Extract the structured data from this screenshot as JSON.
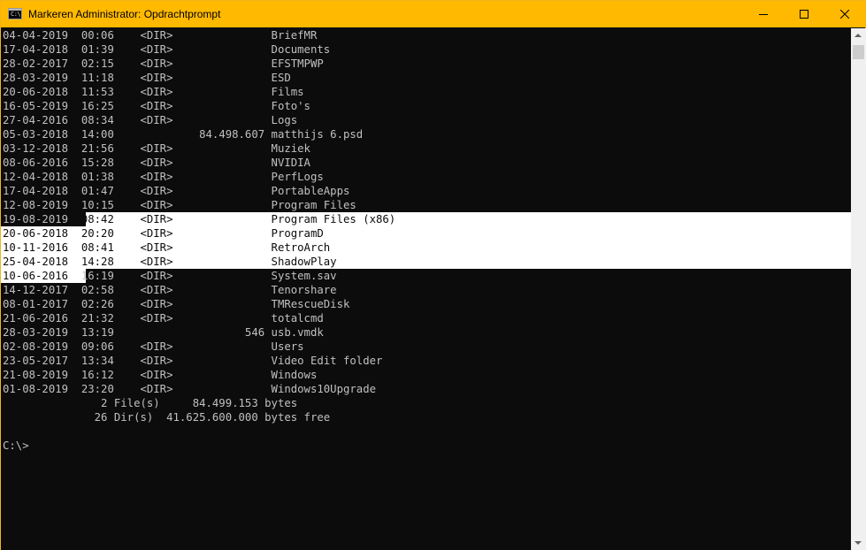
{
  "window": {
    "title": "Markeren Administrator: Opdrachtprompt",
    "icon_label": "C:\\",
    "accent_color": "#ffb900",
    "console_bg": "#0c0c0c",
    "console_fg": "#c0c0c0",
    "selection_bg": "#ffffff"
  },
  "caption_buttons": {
    "minimize": "minimize-icon",
    "maximize": "maximize-icon",
    "close": "close-icon"
  },
  "listing": [
    {
      "date": "04-04-2019",
      "time": "00:06",
      "type": "<DIR>",
      "size": "",
      "name": "BriefMR"
    },
    {
      "date": "17-04-2018",
      "time": "01:39",
      "type": "<DIR>",
      "size": "",
      "name": "Documents"
    },
    {
      "date": "28-02-2017",
      "time": "02:15",
      "type": "<DIR>",
      "size": "",
      "name": "EFSTMPWP"
    },
    {
      "date": "28-03-2019",
      "time": "11:18",
      "type": "<DIR>",
      "size": "",
      "name": "ESD"
    },
    {
      "date": "20-06-2018",
      "time": "11:53",
      "type": "<DIR>",
      "size": "",
      "name": "Films"
    },
    {
      "date": "16-05-2019",
      "time": "16:25",
      "type": "<DIR>",
      "size": "",
      "name": "Foto's"
    },
    {
      "date": "27-04-2016",
      "time": "08:34",
      "type": "<DIR>",
      "size": "",
      "name": "Logs"
    },
    {
      "date": "05-03-2018",
      "time": "14:00",
      "type": "",
      "size": "84.498.607",
      "name": "matthijs 6.psd"
    },
    {
      "date": "03-12-2018",
      "time": "21:56",
      "type": "<DIR>",
      "size": "",
      "name": "Muziek"
    },
    {
      "date": "08-06-2016",
      "time": "15:28",
      "type": "<DIR>",
      "size": "",
      "name": "NVIDIA"
    },
    {
      "date": "12-04-2018",
      "time": "01:38",
      "type": "<DIR>",
      "size": "",
      "name": "PerfLogs"
    },
    {
      "date": "17-04-2018",
      "time": "01:47",
      "type": "<DIR>",
      "size": "",
      "name": "PortableApps"
    },
    {
      "date": "12-08-2019",
      "time": "10:15",
      "type": "<DIR>",
      "size": "",
      "name": "Program Files"
    },
    {
      "date": "19-08-2019",
      "time": "08:42",
      "type": "<DIR>",
      "size": "",
      "name": "Program Files (x86)"
    },
    {
      "date": "20-06-2018",
      "time": "20:20",
      "type": "<DIR>",
      "size": "",
      "name": "ProgramD"
    },
    {
      "date": "10-11-2016",
      "time": "08:41",
      "type": "<DIR>",
      "size": "",
      "name": "RetroArch"
    },
    {
      "date": "25-04-2018",
      "time": "14:28",
      "type": "<DIR>",
      "size": "",
      "name": "ShadowPlay"
    },
    {
      "date": "10-06-2016",
      "time": "16:19",
      "type": "<DIR>",
      "size": "",
      "name": "System.sav"
    },
    {
      "date": "14-12-2017",
      "time": "02:58",
      "type": "<DIR>",
      "size": "",
      "name": "Tenorshare"
    },
    {
      "date": "08-01-2017",
      "time": "02:26",
      "type": "<DIR>",
      "size": "",
      "name": "TMRescueDisk"
    },
    {
      "date": "21-06-2016",
      "time": "21:32",
      "type": "<DIR>",
      "size": "",
      "name": "totalcmd"
    },
    {
      "date": "28-03-2019",
      "time": "13:19",
      "type": "",
      "size": "546",
      "name": "usb.vmdk"
    },
    {
      "date": "02-08-2019",
      "time": "09:06",
      "type": "<DIR>",
      "size": "",
      "name": "Users"
    },
    {
      "date": "23-05-2017",
      "time": "13:34",
      "type": "<DIR>",
      "size": "",
      "name": "Video Edit folder"
    },
    {
      "date": "21-08-2019",
      "time": "16:12",
      "type": "<DIR>",
      "size": "",
      "name": "Windows"
    },
    {
      "date": "01-08-2019",
      "time": "23:20",
      "type": "<DIR>",
      "size": "",
      "name": "Windows10Upgrade"
    }
  ],
  "summary": {
    "files_count": "2",
    "files_label": "File(s)",
    "files_bytes": "84.499.153",
    "files_unit": "bytes",
    "dirs_count": "26",
    "dirs_label": "Dir(s)",
    "dirs_bytes": "41.625.600.000",
    "dirs_unit": "bytes free"
  },
  "prompt": "C:\\>"
}
